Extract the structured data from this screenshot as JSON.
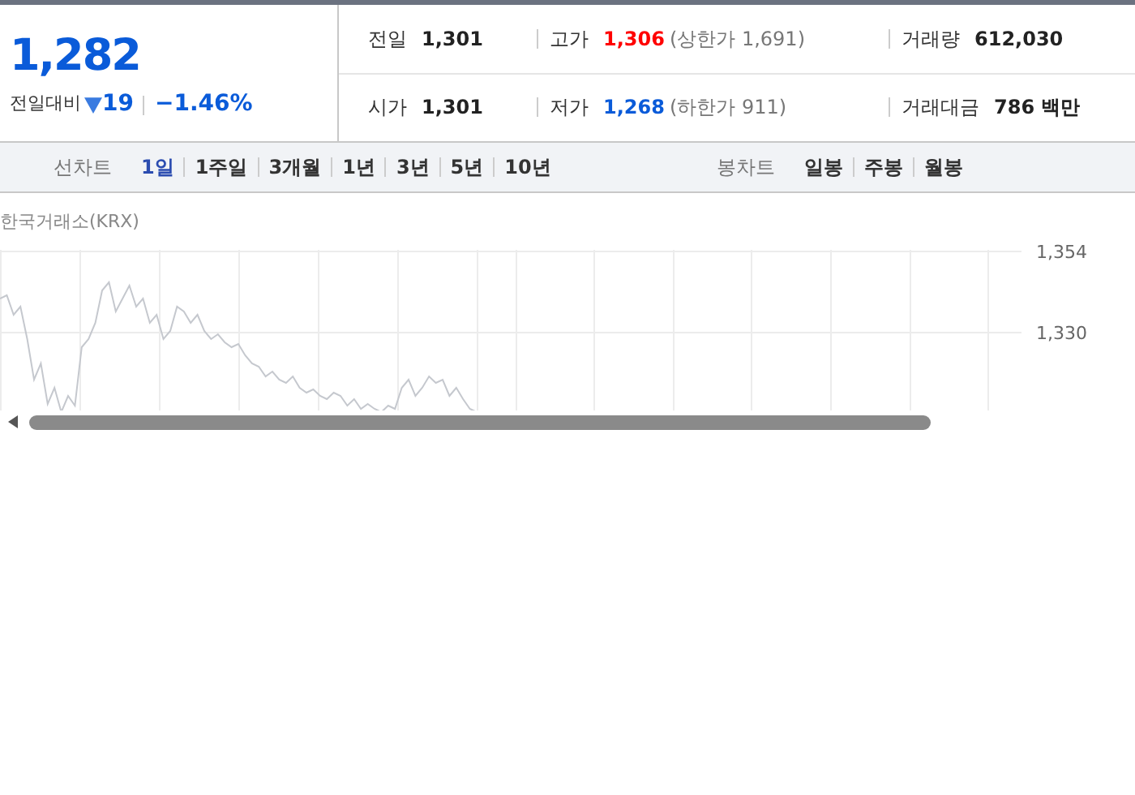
{
  "price": {
    "value": "1,282",
    "change_label": "전일대비",
    "change": "19",
    "kind": "fall",
    "color": "#0a5bd9",
    "rate": "−1.46%"
  },
  "stats": [
    [
      {
        "label": "전일",
        "value": "1,301",
        "color": "#222222"
      },
      {
        "label": "고가",
        "value": "1,306",
        "color": "#ff0000",
        "note": "(상한가 1,691)"
      },
      {
        "label": "거래량",
        "value": "612,030",
        "color": "#222222"
      }
    ],
    [
      {
        "label": "시가",
        "value": "1,301",
        "color": "#222222"
      },
      {
        "label": "저가",
        "value": "1,268",
        "color": "#0a5bd9",
        "note": "(하한가 911)"
      },
      {
        "label": "거래대금",
        "value": "786 백만",
        "color": "#222222"
      }
    ]
  ],
  "line_chart": {
    "label": "선차트",
    "periods": [
      {
        "label": "1일",
        "selected": true
      },
      {
        "label": "1주일",
        "selected": false
      },
      {
        "label": "3개월",
        "selected": false
      },
      {
        "label": "1년",
        "selected": false
      },
      {
        "label": "3년",
        "selected": false
      },
      {
        "label": "5년",
        "selected": false
      },
      {
        "label": "10년",
        "selected": false
      }
    ]
  },
  "candle_chart": {
    "label": "봉차트",
    "periods": [
      {
        "label": "일봉",
        "selected": false
      },
      {
        "label": "주봉",
        "selected": false
      },
      {
        "label": "월봉",
        "selected": false
      }
    ]
  },
  "chart": {
    "source": "한국거래소(KRX)",
    "y_labels": [
      "1,354",
      "1,330"
    ]
  }
}
